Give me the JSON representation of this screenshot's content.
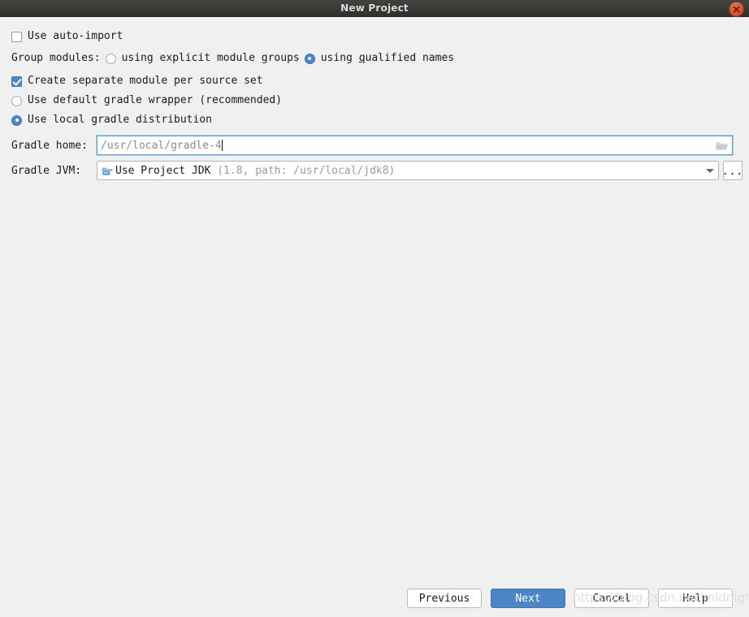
{
  "window": {
    "title": "New Project",
    "close_icon": "close-icon"
  },
  "options": {
    "auto_import": {
      "label": "Use auto-import",
      "checked": false
    },
    "group_modules": {
      "label": "Group modules:",
      "option_explicit": "using explicit module groups",
      "option_explicit_mnemonic": "g",
      "option_qualified": "using qualified names",
      "option_qualified_mnemonic": "q",
      "selected": "using qualified names"
    },
    "separate_module": {
      "label": "Create separate module per source set",
      "checked": true
    },
    "gradle_wrapper": {
      "label": "Use default gradle wrapper (recommended)",
      "selected": false
    },
    "local_distribution": {
      "label": "Use local gradle distribution",
      "selected": true
    }
  },
  "fields": {
    "gradle_home": {
      "label": "Gradle home:",
      "value": "/usr/local/gradle-4",
      "browse_icon": "folder-icon",
      "focused": true
    },
    "gradle_jvm": {
      "label": "Gradle JVM:",
      "value_main": "Use Project JDK",
      "value_detail": " (1.8, path: /usr/local/jdk8)",
      "icon": "jdk-module-icon",
      "dropdown_icon": "chevron-down-icon",
      "browse_label": "..."
    }
  },
  "footer": {
    "previous_label": "Previous",
    "next_label": "Next",
    "cancel_label": "Cancel",
    "help_label": "Help"
  },
  "watermark": {
    "text": "https://blog.csdn.net/midnight"
  },
  "colors": {
    "accent": "#4a86c8",
    "titlebar": "#3b3a36",
    "close": "#d2522b",
    "background": "#f0f0f0",
    "focus_border": "#5a9fd4"
  }
}
